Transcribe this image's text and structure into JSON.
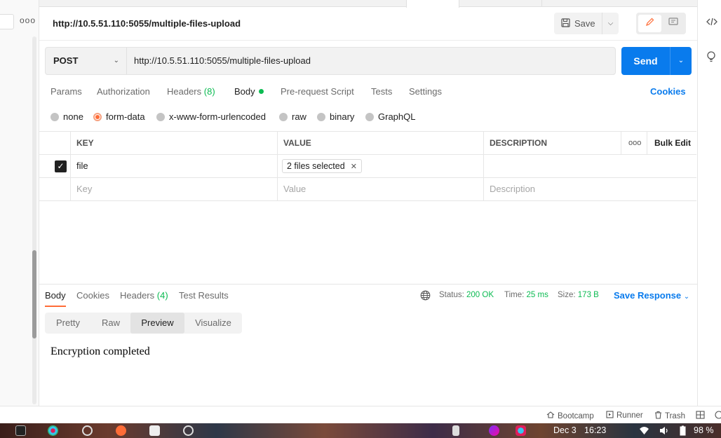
{
  "sidebar": {
    "more_label": "ooo"
  },
  "request": {
    "title": "http://10.5.51.110:5055/multiple-files-upload",
    "save_label": "Save",
    "method": "POST",
    "url": "http://10.5.51.110:5055/multiple-files-upload",
    "send_label": "Send"
  },
  "request_tabs": [
    {
      "label": "Params"
    },
    {
      "label": "Authorization"
    },
    {
      "label": "Headers",
      "count": "(8)"
    },
    {
      "label": "Body"
    },
    {
      "label": "Pre-request Script"
    },
    {
      "label": "Tests"
    },
    {
      "label": "Settings"
    }
  ],
  "cookies_label": "Cookies",
  "body_types": [
    {
      "label": "none",
      "selected": false
    },
    {
      "label": "form-data",
      "selected": true
    },
    {
      "label": "x-www-form-urlencoded",
      "selected": false
    },
    {
      "label": "raw",
      "selected": false
    },
    {
      "label": "binary",
      "selected": false
    },
    {
      "label": "GraphQL",
      "selected": false
    }
  ],
  "table": {
    "headers": {
      "key": "KEY",
      "value": "VALUE",
      "description": "DESCRIPTION",
      "more": "ooo",
      "bulk_edit": "Bulk Edit"
    },
    "rows": [
      {
        "key": "file",
        "value": "2 files selected",
        "description": "",
        "checked": true
      }
    ],
    "placeholders": {
      "key": "Key",
      "value": "Value",
      "description": "Description"
    }
  },
  "response": {
    "tabs": [
      {
        "label": "Body"
      },
      {
        "label": "Cookies"
      },
      {
        "label": "Headers",
        "count": "(4)"
      },
      {
        "label": "Test Results"
      }
    ],
    "status_label": "Status:",
    "status_value": "200 OK",
    "time_label": "Time:",
    "time_value": "25 ms",
    "size_label": "Size:",
    "size_value": "173 B",
    "save_response_label": "Save Response",
    "views": [
      "Pretty",
      "Raw",
      "Preview",
      "Visualize"
    ],
    "active_view": "Preview",
    "preview_text": "Encryption completed"
  },
  "status_bar": {
    "bootcamp": "Bootcamp",
    "runner": "Runner",
    "trash": "Trash"
  },
  "taskbar": {
    "date": "Dec 3",
    "time": "16:23",
    "battery": "98 %"
  },
  "colors": {
    "accent_orange": "#ff6c37",
    "primary_blue": "#097bed",
    "success_green": "#0cbb52"
  }
}
